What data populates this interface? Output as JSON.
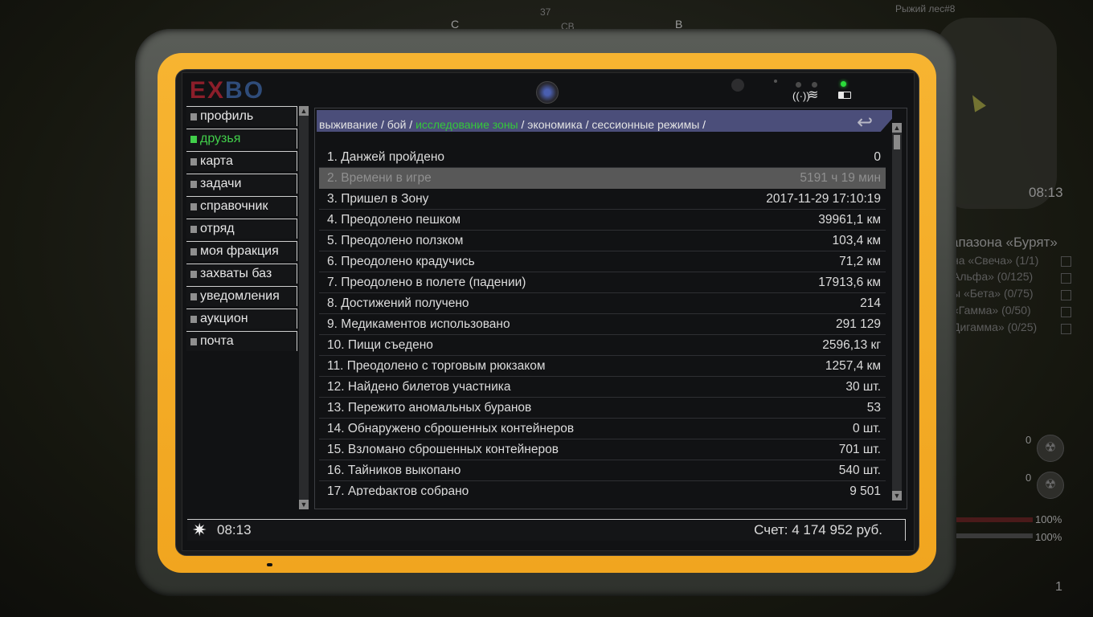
{
  "hud": {
    "compass": {
      "c": "С",
      "deg": "37",
      "ne": "СВ",
      "e": "В"
    },
    "location": "Рыжий лес#8",
    "clock": "08:13",
    "quest": {
      "title": "апазона «Бурят»",
      "lines": [
        "на «Свеча» (1/1)",
        "Альфа» (0/125)",
        "ы «Бета» (0/75)",
        "«Гамма» (0/50)",
        "Дигамма» (0/25)"
      ]
    },
    "indicators": {
      "radiation_value": "0",
      "psy_value": "0",
      "health_pct": "100%",
      "stamina_pct": "100%",
      "ammo": "1"
    }
  },
  "tablet": {
    "logo": {
      "part1": "EX",
      "part2": "BO"
    },
    "menu": [
      {
        "label": "профиль",
        "active": false
      },
      {
        "label": "друзья",
        "active": true
      },
      {
        "label": "карта",
        "active": false
      },
      {
        "label": "задачи",
        "active": false
      },
      {
        "label": "справочник",
        "active": false
      },
      {
        "label": "отряд",
        "active": false
      },
      {
        "label": "моя фракция",
        "active": false
      },
      {
        "label": "захваты баз",
        "active": false
      },
      {
        "label": "уведомления",
        "active": false
      },
      {
        "label": "аукцион",
        "active": false
      },
      {
        "label": "почта",
        "active": false
      }
    ],
    "breadcrumb": [
      "выживание",
      "бой",
      "исследование зоны",
      "экономика",
      "сессионные режимы"
    ],
    "breadcrumb_current_index": 2,
    "stats": [
      {
        "label": "1.  Данжей пройдено",
        "value": "0"
      },
      {
        "label": "2.  Времени в игре",
        "value": "5191 ч 19 мин"
      },
      {
        "label": "3.  Пришел в Зону",
        "value": "2017-11-29 17:10:19"
      },
      {
        "label": "4.  Преодолено пешком",
        "value": "39961,1 км"
      },
      {
        "label": "5.  Преодолено ползком",
        "value": "103,4 км"
      },
      {
        "label": "6.  Преодолено крадучись",
        "value": "71,2 км"
      },
      {
        "label": "7.  Преодолено в полете (падении)",
        "value": "17913,6 км"
      },
      {
        "label": "8.  Достижений получено",
        "value": "214"
      },
      {
        "label": "9.  Медикаментов использовано",
        "value": "291 129"
      },
      {
        "label": "10.  Пищи съедено",
        "value": "2596,13 кг"
      },
      {
        "label": "11.  Преодолено с торговым рюкзаком",
        "value": "1257,4 км"
      },
      {
        "label": "12.  Найдено билетов участника",
        "value": "30 шт."
      },
      {
        "label": "13.  Пережито аномальных буранов",
        "value": "53"
      },
      {
        "label": "14.  Обнаружено сброшенных контейнеров",
        "value": "0 шт."
      },
      {
        "label": "15.  Взломано сброшенных контейнеров",
        "value": "701 шт."
      },
      {
        "label": "16.  Тайников выкопано",
        "value": "540 шт."
      },
      {
        "label": "17.  Артефактов собрано",
        "value": "9 501"
      }
    ],
    "selected_row": 1,
    "footer": {
      "time": "08:13",
      "balance": "Счет: 4 174 952 руб."
    }
  }
}
